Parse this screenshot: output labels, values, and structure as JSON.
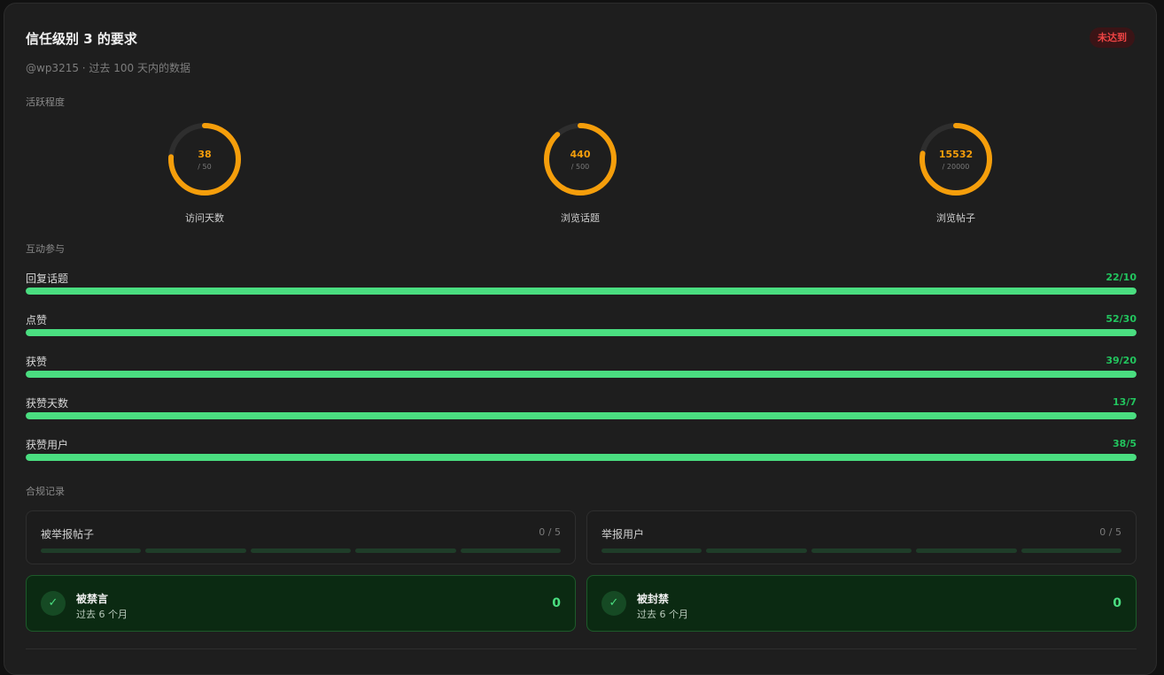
{
  "header": {
    "title": "信任级别 3 的要求",
    "badge": "未达到",
    "subtitle": "@wp3215 · 过去 100 天内的数据"
  },
  "activity": {
    "section_label": "活跃程度",
    "rings": [
      {
        "value": "38",
        "max": "/ 50",
        "label": "访问天数",
        "fraction": 0.76
      },
      {
        "value": "440",
        "max": "/ 500",
        "label": "浏览话题",
        "fraction": 0.88
      },
      {
        "value": "15532",
        "max": "/ 20000",
        "label": "浏览帖子",
        "fraction": 0.7766
      }
    ]
  },
  "interaction": {
    "section_label": "互动参与",
    "bars": [
      {
        "label": "回复话题",
        "value": "22/10",
        "fraction": 1.0
      },
      {
        "label": "点赞",
        "value": "52/30",
        "fraction": 1.0
      },
      {
        "label": "获赞",
        "value": "39/20",
        "fraction": 1.0
      },
      {
        "label": "获赞天数",
        "value": "13/7",
        "fraction": 1.0
      },
      {
        "label": "获赞用户",
        "value": "38/5",
        "fraction": 1.0
      }
    ]
  },
  "compliance": {
    "section_label": "合规记录",
    "records": [
      {
        "label": "被举报帖子",
        "count": "0 / 5",
        "filled": 0,
        "segments": 5
      },
      {
        "label": "举报用户",
        "count": "0 / 5",
        "filled": 0,
        "segments": 5
      }
    ],
    "status": [
      {
        "title": "被禁言",
        "subtitle": "过去 6 个月",
        "value": "0",
        "icon": "check-icon"
      },
      {
        "title": "被封禁",
        "subtitle": "过去 6 个月",
        "value": "0",
        "icon": "check-icon"
      }
    ]
  },
  "colors": {
    "ring": "#f59e0b",
    "ring_track": "#2e2e2e",
    "bar_fill": "#4ade80",
    "danger": "#ef4444",
    "success": "#22c55e"
  }
}
